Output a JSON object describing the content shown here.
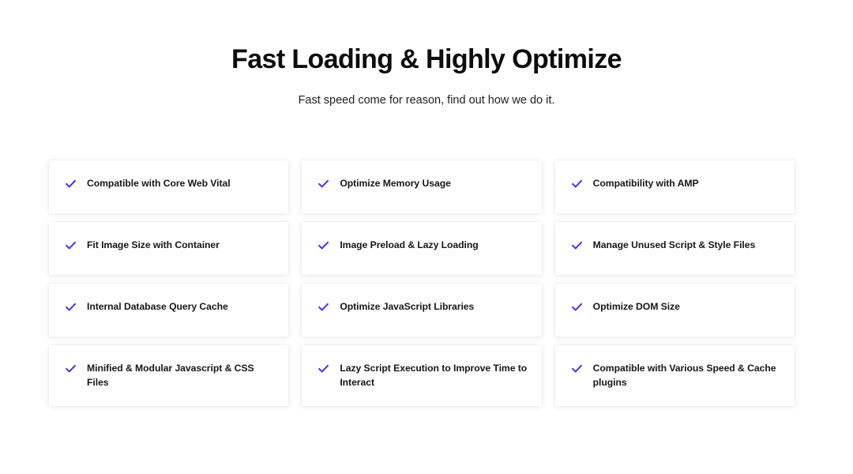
{
  "header": {
    "title": "Fast Loading & Highly Optimize",
    "subtitle": "Fast speed come for reason, find out how we do it."
  },
  "theme": {
    "check_color": "#4b30e8",
    "text_color": "#17171a",
    "card_background": "#ffffff",
    "page_background": "#ffffff",
    "gap_color": "#e6e6e7"
  },
  "features": {
    "icon": "check-icon",
    "items": [
      {
        "label": "Compatible with Core Web Vital"
      },
      {
        "label": "Optimize Memory Usage"
      },
      {
        "label": "Compatibility with AMP"
      },
      {
        "label": "Fit Image Size with Container"
      },
      {
        "label": "Image Preload & Lazy Loading"
      },
      {
        "label": "Manage Unused Script & Style Files"
      },
      {
        "label": "Internal Database Query Cache"
      },
      {
        "label": "Optimize JavaScript Libraries"
      },
      {
        "label": "Optimize DOM Size"
      },
      {
        "label": "Minified & Modular Javascript & CSS Files"
      },
      {
        "label": "Lazy Script Execution to Improve Time to Interact"
      },
      {
        "label": "Compatible with Various Speed & Cache plugins"
      }
    ]
  }
}
